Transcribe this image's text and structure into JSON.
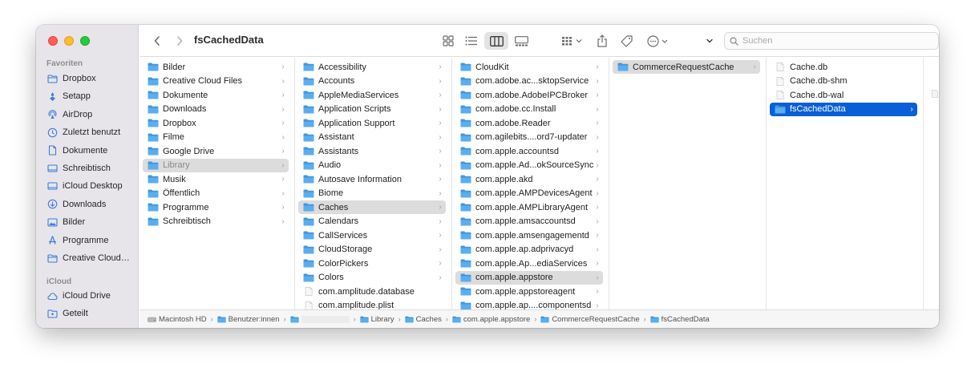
{
  "window": {
    "title": "fsCachedData",
    "search_placeholder": "Suchen"
  },
  "sidebar": {
    "favorites_heading": "Favoriten",
    "favorites": [
      {
        "label": "Dropbox",
        "icon": "folder-icon"
      },
      {
        "label": "Setapp",
        "icon": "setapp-icon"
      },
      {
        "label": "AirDrop",
        "icon": "airdrop-icon"
      },
      {
        "label": "Zuletzt benutzt",
        "icon": "clock-icon"
      },
      {
        "label": "Dokumente",
        "icon": "document-icon"
      },
      {
        "label": "Schreibtisch",
        "icon": "desktop-icon"
      },
      {
        "label": "iCloud Desktop",
        "icon": "desktop-icon"
      },
      {
        "label": "Downloads",
        "icon": "download-icon"
      },
      {
        "label": "Bilder",
        "icon": "photo-icon"
      },
      {
        "label": "Programme",
        "icon": "apps-icon"
      },
      {
        "label": "Creative Cloud…",
        "icon": "folder-icon"
      }
    ],
    "icloud_heading": "iCloud",
    "icloud": [
      {
        "label": "iCloud Drive",
        "icon": "cloud-icon"
      },
      {
        "label": "Geteilt",
        "icon": "shared-folder-icon"
      }
    ]
  },
  "columns": [
    {
      "items": [
        {
          "label": "Bilder",
          "type": "folder",
          "chevron": true
        },
        {
          "label": "Creative Cloud Files",
          "type": "folder",
          "chevron": true
        },
        {
          "label": "Dokumente",
          "type": "folder",
          "chevron": true
        },
        {
          "label": "Downloads",
          "type": "folder",
          "chevron": true
        },
        {
          "label": "Dropbox",
          "type": "folder",
          "chevron": true
        },
        {
          "label": "Filme",
          "type": "folder",
          "chevron": true
        },
        {
          "label": "Google Drive",
          "type": "folder",
          "chevron": true
        },
        {
          "label": "Library",
          "type": "folder",
          "chevron": true,
          "state": "selected-gray",
          "dim": true
        },
        {
          "label": "Musik",
          "type": "folder",
          "chevron": true
        },
        {
          "label": "Öffentlich",
          "type": "folder",
          "chevron": true
        },
        {
          "label": "Programme",
          "type": "folder",
          "chevron": true
        },
        {
          "label": "Schreibtisch",
          "type": "folder",
          "chevron": true
        }
      ]
    },
    {
      "items": [
        {
          "label": "Accessibility",
          "type": "folder",
          "chevron": true
        },
        {
          "label": "Accounts",
          "type": "folder",
          "chevron": true
        },
        {
          "label": "AppleMediaServices",
          "type": "folder",
          "chevron": true
        },
        {
          "label": "Application Scripts",
          "type": "folder",
          "chevron": true
        },
        {
          "label": "Application Support",
          "type": "folder",
          "chevron": true
        },
        {
          "label": "Assistant",
          "type": "folder",
          "chevron": true
        },
        {
          "label": "Assistants",
          "type": "folder",
          "chevron": true
        },
        {
          "label": "Audio",
          "type": "folder",
          "chevron": true
        },
        {
          "label": "Autosave Information",
          "type": "folder",
          "chevron": true
        },
        {
          "label": "Biome",
          "type": "folder",
          "chevron": true
        },
        {
          "label": "Caches",
          "type": "folder",
          "chevron": true,
          "state": "selected-gray"
        },
        {
          "label": "Calendars",
          "type": "folder",
          "chevron": true
        },
        {
          "label": "CallServices",
          "type": "folder",
          "chevron": true
        },
        {
          "label": "CloudStorage",
          "type": "folder",
          "chevron": true
        },
        {
          "label": "ColorPickers",
          "type": "folder",
          "chevron": true
        },
        {
          "label": "Colors",
          "type": "folder",
          "chevron": true
        },
        {
          "label": "com.amplitude.database",
          "type": "file",
          "chevron": false
        },
        {
          "label": "com.amplitude.plist",
          "type": "file",
          "chevron": false
        }
      ]
    },
    {
      "items": [
        {
          "label": "CloudKit",
          "type": "folder",
          "chevron": true
        },
        {
          "label": "com.adobe.ac...sktopService",
          "type": "folder",
          "chevron": true
        },
        {
          "label": "com.adobe.AdobeIPCBroker",
          "type": "folder",
          "chevron": true
        },
        {
          "label": "com.adobe.cc.Install",
          "type": "folder",
          "chevron": true
        },
        {
          "label": "com.adobe.Reader",
          "type": "folder",
          "chevron": true
        },
        {
          "label": "com.agilebits....ord7-updater",
          "type": "folder",
          "chevron": true
        },
        {
          "label": "com.apple.accountsd",
          "type": "folder",
          "chevron": true
        },
        {
          "label": "com.apple.Ad...okSourceSync",
          "type": "folder",
          "chevron": true
        },
        {
          "label": "com.apple.akd",
          "type": "folder",
          "chevron": true
        },
        {
          "label": "com.apple.AMPDevicesAgent",
          "type": "folder",
          "chevron": true
        },
        {
          "label": "com.apple.AMPLibraryAgent",
          "type": "folder",
          "chevron": true
        },
        {
          "label": "com.apple.amsaccountsd",
          "type": "folder",
          "chevron": true
        },
        {
          "label": "com.apple.amsengagementd",
          "type": "folder",
          "chevron": true
        },
        {
          "label": "com.apple.ap.adprivacyd",
          "type": "folder",
          "chevron": true
        },
        {
          "label": "com.apple.Ap...ediaServices",
          "type": "folder",
          "chevron": true
        },
        {
          "label": "com.apple.appstore",
          "type": "folder",
          "chevron": true,
          "state": "selected-gray"
        },
        {
          "label": "com.apple.appstoreagent",
          "type": "folder",
          "chevron": true
        },
        {
          "label": "com.apple.ap....componentsd",
          "type": "folder",
          "chevron": true
        }
      ]
    },
    {
      "items": [
        {
          "label": "CommerceRequestCache",
          "type": "folder",
          "chevron": true,
          "state": "selected-gray"
        }
      ]
    },
    {
      "items": [
        {
          "label": "Cache.db",
          "type": "file",
          "chevron": false
        },
        {
          "label": "Cache.db-shm",
          "type": "file",
          "chevron": false
        },
        {
          "label": "Cache.db-wal",
          "type": "file",
          "chevron": false
        },
        {
          "label": "fsCachedData",
          "type": "folder",
          "chevron": true,
          "state": "selected-blue"
        }
      ]
    }
  ],
  "pathbar": {
    "items": [
      {
        "label": "Macintosh HD",
        "icon": "disk-icon"
      },
      {
        "label": "Benutzer:innen",
        "icon": "folder-icon"
      },
      {
        "label": "",
        "icon": "folder-icon",
        "redacted": true
      },
      {
        "label": "Library",
        "icon": "folder-icon"
      },
      {
        "label": "Caches",
        "icon": "folder-icon"
      },
      {
        "label": "com.apple.appstore",
        "icon": "folder-icon"
      },
      {
        "label": "CommerceRequestCache",
        "icon": "folder-icon"
      },
      {
        "label": "fsCachedData",
        "icon": "folder-icon"
      }
    ]
  },
  "colors": {
    "folder": "#5aaef0",
    "folder_dark": "#3f97e0",
    "selection_blue": "#0a5fd6",
    "selection_gray": "#dcdcdc",
    "sidebar_icon": "#3b7ce0"
  }
}
